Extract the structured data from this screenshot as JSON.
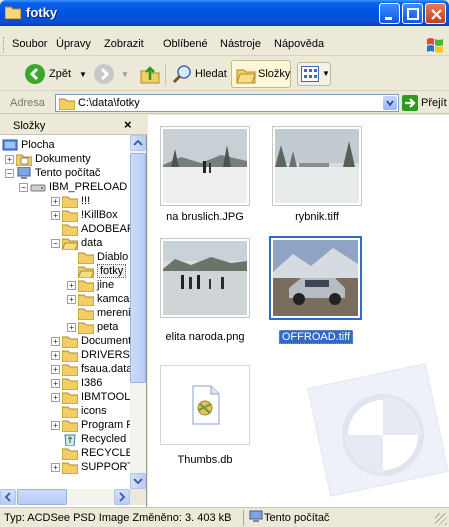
{
  "window": {
    "title": "fotky"
  },
  "menu": {
    "items": [
      "Soubor",
      "Úpravy",
      "Zobrazit",
      "Oblíbené",
      "Nástroje",
      "Nápověda"
    ]
  },
  "toolbar": {
    "back_label": "Zpět",
    "search_label": "Hledat",
    "folders_label": "Složky"
  },
  "address": {
    "label": "Adresa",
    "path": "C:\\data\\fotky",
    "go_label": "Přejít"
  },
  "folder_pane": {
    "title": "Složky",
    "close": "×",
    "tree": [
      {
        "label": "Plocha"
      },
      {
        "label": "Dokumenty"
      },
      {
        "label": "Tento počítač"
      },
      {
        "label": "IBM_PRELOAD"
      },
      {
        "label": "!!!"
      },
      {
        "label": "!KillBox"
      },
      {
        "label": "ADOBEAPP"
      },
      {
        "label": "data"
      },
      {
        "label": "Diablo"
      },
      {
        "label": "fotky"
      },
      {
        "label": "jine"
      },
      {
        "label": "kamca"
      },
      {
        "label": "mereni"
      },
      {
        "label": "peta"
      },
      {
        "label": "Documents"
      },
      {
        "label": "DRIVERS"
      },
      {
        "label": "fsaua.data"
      },
      {
        "label": "I386"
      },
      {
        "label": "IBMTOOLS"
      },
      {
        "label": "icons"
      },
      {
        "label": "Program Fil"
      },
      {
        "label": "Recycled"
      },
      {
        "label": "RECYCLER"
      },
      {
        "label": "SUPPORT"
      }
    ]
  },
  "files": [
    {
      "name": "na bruslich.JPG",
      "selected": false
    },
    {
      "name": "rybnik.tiff",
      "selected": false
    },
    {
      "name": "elita naroda.png",
      "selected": false
    },
    {
      "name": "OFFROAD.tiff",
      "selected": true
    },
    {
      "name": "Thumbs.db",
      "selected": false
    }
  ],
  "status": {
    "info": "Typ: ACDSee PSD Image Změněno: 3. 403 kB",
    "location": "Tento počítač"
  },
  "colors": {
    "titlebar": "#0054e3",
    "selection": "#316ac5",
    "chrome": "#ece9d8"
  }
}
